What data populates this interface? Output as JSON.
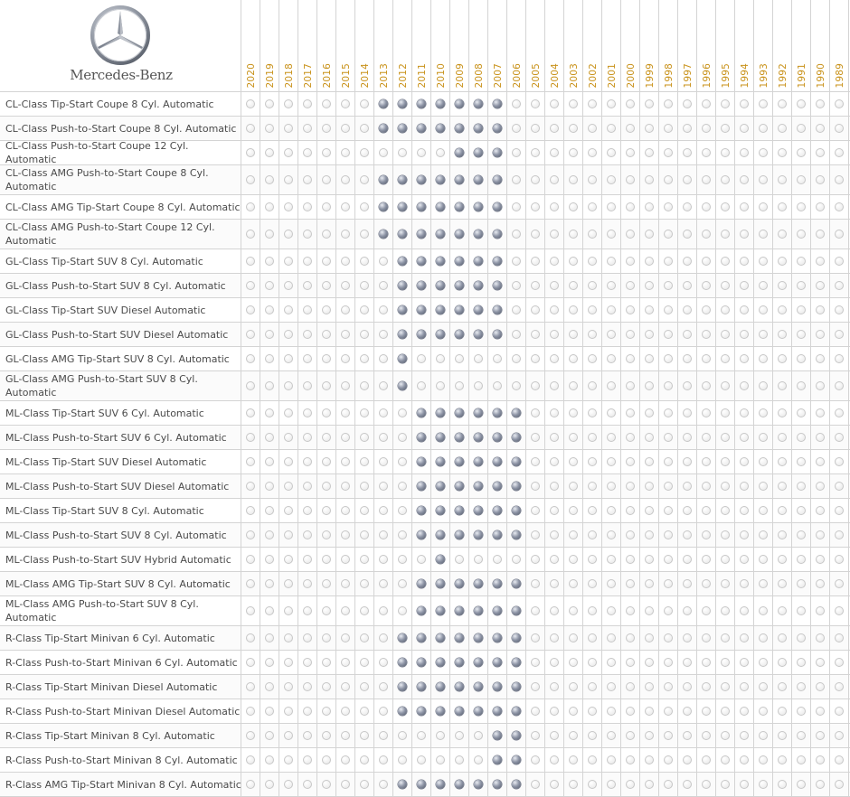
{
  "brand": {
    "name": "Mercedes-Benz",
    "logo_icon": "mercedes-star-icon"
  },
  "colors": {
    "year_label": "#c9921a",
    "filled_dot": "#6d7383",
    "grid_line": "#d4d4d4"
  },
  "years": [
    "2020",
    "2019",
    "2018",
    "2017",
    "2016",
    "2015",
    "2014",
    "2013",
    "2012",
    "2011",
    "2010",
    "2009",
    "2008",
    "2007",
    "2006",
    "2005",
    "2004",
    "2003",
    "2002",
    "2001",
    "2000",
    "1999",
    "1998",
    "1997",
    "1996",
    "1995",
    "1994",
    "1993",
    "1992",
    "1991",
    "1990",
    "1989"
  ],
  "rows": [
    {
      "label": "CL-Class Tip-Start Coupe 8 Cyl. Automatic",
      "years": [
        "2013",
        "2012",
        "2011",
        "2010",
        "2009",
        "2008",
        "2007"
      ]
    },
    {
      "label": "CL-Class Push-to-Start Coupe 8 Cyl. Automatic",
      "years": [
        "2013",
        "2012",
        "2011",
        "2010",
        "2009",
        "2008",
        "2007"
      ]
    },
    {
      "label": "CL-Class Push-to-Start Coupe 12 Cyl. Automatic",
      "years": [
        "2009",
        "2008",
        "2007"
      ]
    },
    {
      "label": "CL-Class AMG Push-to-Start Coupe 8 Cyl. Automatic",
      "years": [
        "2013",
        "2012",
        "2011",
        "2010",
        "2009",
        "2008",
        "2007"
      ]
    },
    {
      "label": "CL-Class AMG Tip-Start Coupe 8 Cyl. Automatic",
      "years": [
        "2013",
        "2012",
        "2011",
        "2010",
        "2009",
        "2008",
        "2007"
      ]
    },
    {
      "label": "CL-Class AMG Push-to-Start Coupe 12 Cyl. Automatic",
      "years": [
        "2013",
        "2012",
        "2011",
        "2010",
        "2009",
        "2008",
        "2007"
      ]
    },
    {
      "label": "GL-Class Tip-Start SUV 8 Cyl. Automatic",
      "years": [
        "2012",
        "2011",
        "2010",
        "2009",
        "2008",
        "2007"
      ]
    },
    {
      "label": "GL-Class Push-to-Start SUV 8 Cyl. Automatic",
      "years": [
        "2012",
        "2011",
        "2010",
        "2009",
        "2008",
        "2007"
      ]
    },
    {
      "label": "GL-Class Tip-Start SUV Diesel Automatic",
      "years": [
        "2012",
        "2011",
        "2010",
        "2009",
        "2008",
        "2007"
      ]
    },
    {
      "label": "GL-Class Push-to-Start SUV Diesel Automatic",
      "years": [
        "2012",
        "2011",
        "2010",
        "2009",
        "2008",
        "2007"
      ]
    },
    {
      "label": "GL-Class AMG Tip-Start SUV 8 Cyl. Automatic",
      "years": [
        "2012"
      ]
    },
    {
      "label": "GL-Class AMG Push-to-Start SUV 8 Cyl. Automatic",
      "years": [
        "2012"
      ]
    },
    {
      "label": "ML-Class Tip-Start SUV 6 Cyl. Automatic",
      "years": [
        "2011",
        "2010",
        "2009",
        "2008",
        "2007",
        "2006"
      ]
    },
    {
      "label": "ML-Class Push-to-Start SUV 6 Cyl. Automatic",
      "years": [
        "2011",
        "2010",
        "2009",
        "2008",
        "2007",
        "2006"
      ]
    },
    {
      "label": "ML-Class Tip-Start SUV Diesel Automatic",
      "years": [
        "2011",
        "2010",
        "2009",
        "2008",
        "2007",
        "2006"
      ]
    },
    {
      "label": "ML-Class Push-to-Start SUV Diesel Automatic",
      "years": [
        "2011",
        "2010",
        "2009",
        "2008",
        "2007",
        "2006"
      ]
    },
    {
      "label": "ML-Class Tip-Start SUV 8 Cyl. Automatic",
      "years": [
        "2011",
        "2010",
        "2009",
        "2008",
        "2007",
        "2006"
      ]
    },
    {
      "label": "ML-Class Push-to-Start SUV 8 Cyl. Automatic",
      "years": [
        "2011",
        "2010",
        "2009",
        "2008",
        "2007",
        "2006"
      ]
    },
    {
      "label": "ML-Class Push-to-Start SUV Hybrid Automatic",
      "years": [
        "2010"
      ]
    },
    {
      "label": "ML-Class AMG Tip-Start SUV 8 Cyl. Automatic",
      "years": [
        "2011",
        "2010",
        "2009",
        "2008",
        "2007",
        "2006"
      ]
    },
    {
      "label": "ML-Class AMG Push-to-Start SUV 8 Cyl. Automatic",
      "years": [
        "2011",
        "2010",
        "2009",
        "2008",
        "2007",
        "2006"
      ]
    },
    {
      "label": "R-Class Tip-Start Minivan 6 Cyl. Automatic",
      "years": [
        "2012",
        "2011",
        "2010",
        "2009",
        "2008",
        "2007",
        "2006"
      ]
    },
    {
      "label": "R-Class Push-to-Start Minivan 6 Cyl. Automatic",
      "years": [
        "2012",
        "2011",
        "2010",
        "2009",
        "2008",
        "2007",
        "2006"
      ]
    },
    {
      "label": "R-Class Tip-Start Minivan Diesel Automatic",
      "years": [
        "2012",
        "2011",
        "2010",
        "2009",
        "2008",
        "2007",
        "2006"
      ]
    },
    {
      "label": "R-Class Push-to-Start Minivan Diesel Automatic",
      "years": [
        "2012",
        "2011",
        "2010",
        "2009",
        "2008",
        "2007",
        "2006"
      ]
    },
    {
      "label": "R-Class Tip-Start Minivan 8 Cyl. Automatic",
      "years": [
        "2007",
        "2006"
      ]
    },
    {
      "label": "R-Class Push-to-Start Minivan 8 Cyl. Automatic",
      "years": [
        "2007",
        "2006"
      ]
    },
    {
      "label": "R-Class AMG Tip-Start Minivan 8 Cyl. Automatic",
      "years": [
        "2012",
        "2011",
        "2010",
        "2009",
        "2008",
        "2007",
        "2006"
      ]
    }
  ]
}
